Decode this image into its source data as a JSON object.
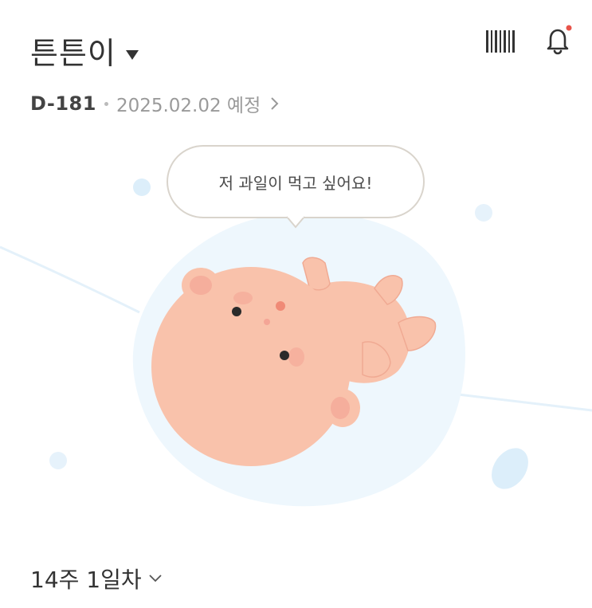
{
  "header": {
    "baby_name": "튼튼이",
    "dropdown_icon": "caret-down-icon",
    "barcode_icon": "barcode-icon",
    "bell_icon": "bell-icon",
    "notification_dot_color": "#e8534a"
  },
  "pregnancy": {
    "d_day": "D-181",
    "due_date": "2025.02.02 예정"
  },
  "speech_bubble": {
    "text": "저 과일이 먹고 싶어요!"
  },
  "week_info": {
    "label": "14주 1일차"
  },
  "colors": {
    "skin": "#f9c2ab",
    "cheek": "#f4a596",
    "womb": "#eef7fd",
    "bubble_dot": "#dceefa"
  }
}
